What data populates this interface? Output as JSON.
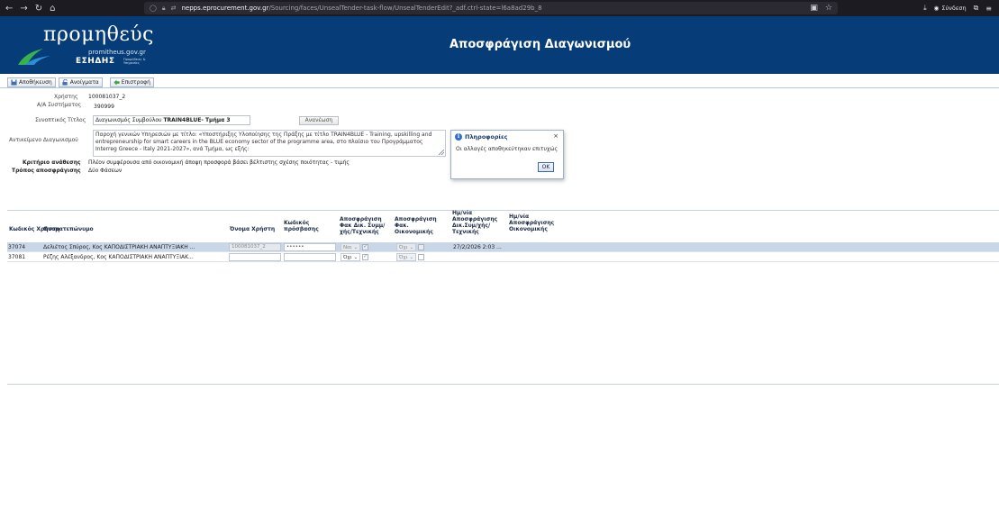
{
  "browser": {
    "url_host": "nepps.eprocurement.gov.gr",
    "url_rest": "/Sourcing/faces/UnsealTender-task-flow/UnsealTenderEdit?_adf.ctrl-state=l6a8ad29b_8",
    "login_label": "Σύνδεση"
  },
  "header": {
    "brand": "προμηθεύς",
    "domain": "promitheus.gov.gr",
    "esidis": "ΕΣΗΔΗΣ",
    "esidis_sub": "Προμήθειες & Υπηρεσίες",
    "page_title": "Αποσφράγιση Διαγωνισμού"
  },
  "toolbar": {
    "save": "Αποθήκευση",
    "open": "Ανοίγματα",
    "back": "Επιστροφή"
  },
  "form": {
    "user_label": "Χρήστης",
    "user_value": "100081037_2",
    "sysno_label": "Α/Α Συστήματος",
    "sysno_value": "390999",
    "title_label": "Συνοπτικός Τίτλος",
    "title_value_prefix": "Διαγωνισμός Συμβούλου",
    "title_value_bold": "TRAIN4BLUE- Τμήμα 3",
    "refresh_label": "Ανανέωση",
    "subject_label": "Αντικείμενο Διαγωνισμού",
    "subject_value": "Παροχή γενικών Υπηρεσιών με τίτλο: «Υποστήριξης Υλοποίησης της Πράξης με τίτλο TRAIN4BLUE - Training, upskilling and entrepreneurship for smart careers in the BLUE economy sector of the programme area, στο πλαίσιο του Προγράμματος Interreg Greece - Italy 2021-2027», ανά Τμήμα, ως εξής:",
    "criterion_label": "Κριτήριο ανάθεσης",
    "criterion_value": "Πλέον συμφέρουσα από οικονομική άποψη προσφορά βάσει βέλτιστης σχέσης ποιότητας - τιμής",
    "opening_label": "Τρόπος αποσφράγισης",
    "opening_value": "Δύο Φάσεων"
  },
  "dialog": {
    "title": "Πληροφορίες",
    "message": "Οι αλλαγές αποθηκεύτηκαν επιτυχώς",
    "ok": "OK",
    "close": "×"
  },
  "grid": {
    "columns": [
      "Κωδικός Χρήστη",
      "Ονοματεπώνυμο",
      "Όνομα Χρήστη",
      "Κωδικός πρόσβασης",
      "Αποσφράγιση Φακ Δικ. Συμμ/ χής/Τεχνικής",
      "Αποσφράγιση Φακ. Οικονομικής",
      "Ημ/νία Αποσφράγισης Δικ.Συμ/χής/ Τεχνικής",
      "Ημ/νία Αποσφράγισης Οικονομικής"
    ],
    "rows": [
      {
        "code": "37074",
        "name": "Δελιέτος Σπύρος, Κος ΚΑΠΟΔΙΣΤΡΙΑΚΗ ΑΝΑΠΤΥΞΙΑΚΗ ...",
        "username": "100081037_2",
        "password": "••••••",
        "tech_select": "Ναι",
        "econ_select": "Όχι",
        "tech_date": "27/2/2026 2:03 ...",
        "econ_date": ""
      },
      {
        "code": "37081",
        "name": "Ρέζης Αλέξανδρος, Κος ΚΑΠΟΔΙΣΤΡΙΑΚΗ ΑΝΑΠΤΥΞΙΑΚ...",
        "username": "",
        "password": "",
        "tech_select": "Όχι",
        "econ_select": "Όχι",
        "tech_date": "",
        "econ_date": ""
      }
    ]
  },
  "colors": {
    "header_bg": "#063c77",
    "selected_row": "#c8d6e8"
  }
}
